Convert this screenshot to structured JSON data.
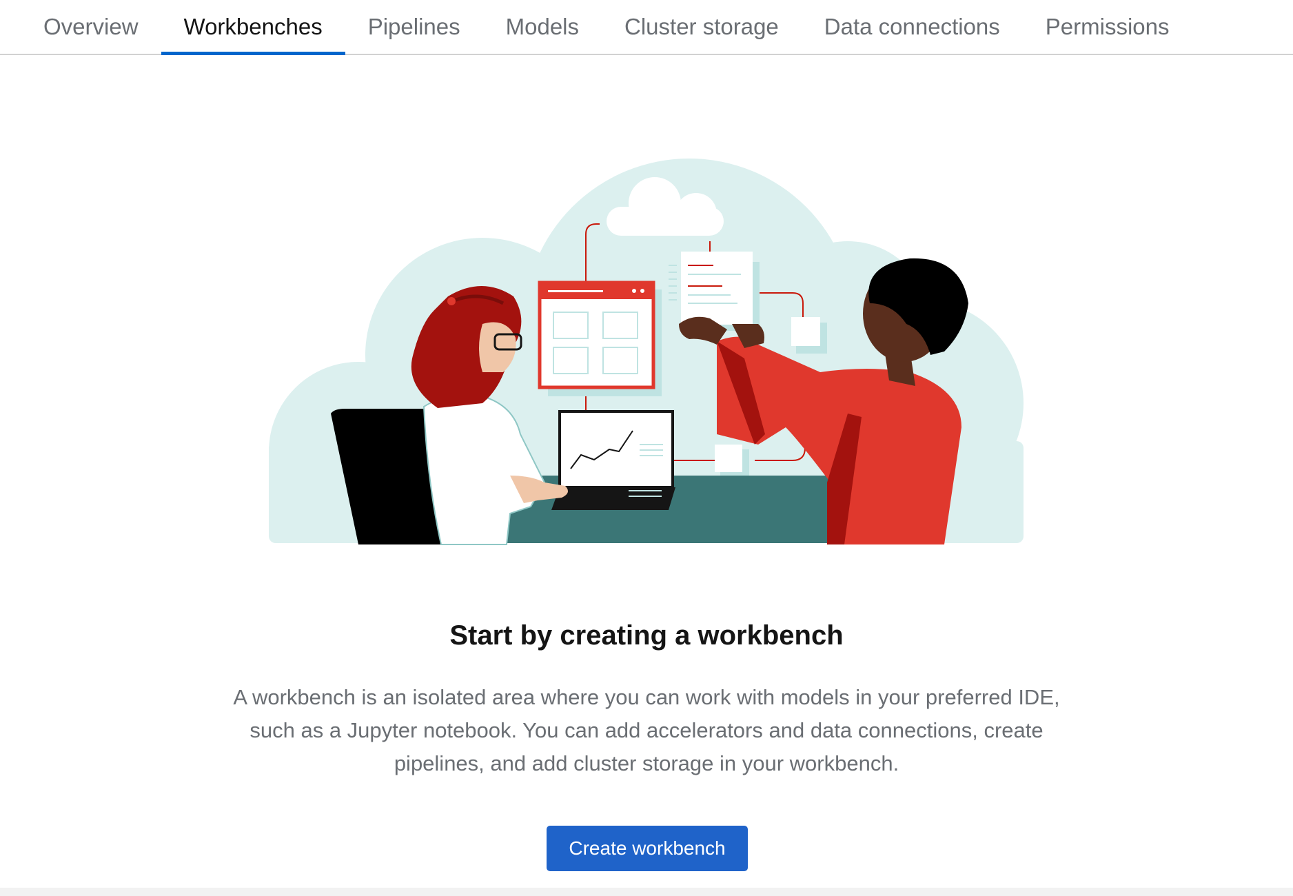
{
  "tabs": [
    {
      "label": "Overview",
      "active": false
    },
    {
      "label": "Workbenches",
      "active": true
    },
    {
      "label": "Pipelines",
      "active": false
    },
    {
      "label": "Models",
      "active": false
    },
    {
      "label": "Cluster storage",
      "active": false
    },
    {
      "label": "Data connections",
      "active": false
    },
    {
      "label": "Permissions",
      "active": false
    }
  ],
  "empty_state": {
    "illustration_icon": "workbench-empty-state-illustration",
    "title": "Start by creating a workbench",
    "description": "A workbench is an isolated area where you can work with models in your preferred IDE, such as a Jupyter notebook. You can add accelerators and data connections, create pipelines, and add cluster storage in your workbench.",
    "button_label": "Create workbench"
  },
  "colors": {
    "accent": "#0066cc",
    "button": "#1f63c9",
    "brand_red": "#e0382d",
    "teal_light": "#dcf0ef",
    "teal_dark": "#3b7676"
  }
}
